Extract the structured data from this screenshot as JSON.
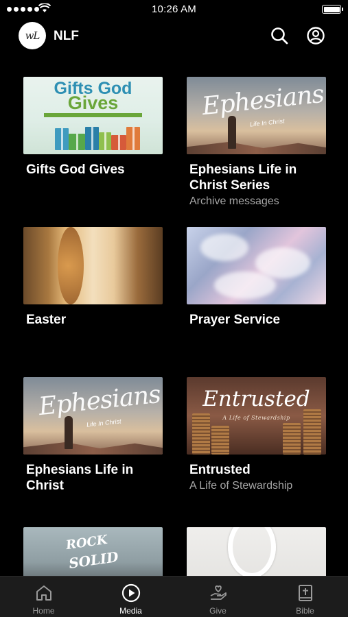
{
  "status_bar": {
    "time": "10:26 AM"
  },
  "header": {
    "title": "NLF",
    "logo_text": "wL"
  },
  "media_items": [
    {
      "title": "Gifts God Gives",
      "subtitle": "",
      "thumb_text_1": "Gifts God",
      "thumb_text_2": "Gives"
    },
    {
      "title": "Ephesians Life in Christ Series",
      "subtitle": "Archive messages",
      "thumb_text_1": "Ephesians",
      "thumb_text_2": "Life In Christ"
    },
    {
      "title": "Easter",
      "subtitle": ""
    },
    {
      "title": "Prayer Service",
      "subtitle": ""
    },
    {
      "title": "Ephesians Life in Christ",
      "subtitle": "",
      "thumb_text_1": "Ephesians",
      "thumb_text_2": "Life In Christ"
    },
    {
      "title": "Entrusted",
      "subtitle": "A Life of Stewardship",
      "thumb_text_1": "Entrusted",
      "thumb_text_2": "A Life of Stewardship"
    },
    {
      "title": "",
      "subtitle": "",
      "thumb_text_1": "ROCK",
      "thumb_text_2": "SOLID"
    },
    {
      "title": "",
      "subtitle": ""
    }
  ],
  "tabs": [
    {
      "label": "Home",
      "icon": "home-icon",
      "active": false
    },
    {
      "label": "Media",
      "icon": "play-circle-icon",
      "active": true
    },
    {
      "label": "Give",
      "icon": "give-hand-heart-icon",
      "active": false
    },
    {
      "label": "Bible",
      "icon": "bible-icon",
      "active": false
    }
  ],
  "colors": {
    "background": "#000000",
    "tab_bar": "#1c1c1c",
    "subtitle": "#a6a6a6",
    "inactive_tab": "#9a9a9a"
  }
}
